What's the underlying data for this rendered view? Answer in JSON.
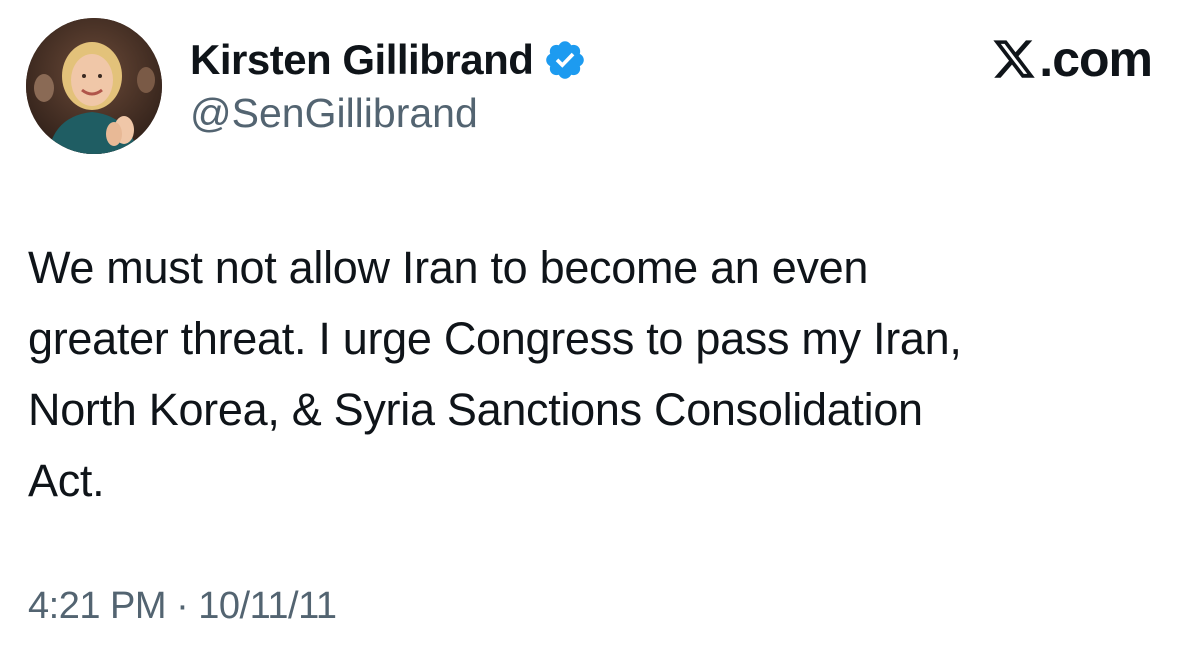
{
  "tweet": {
    "author": {
      "display_name": "Kirsten Gillibrand",
      "handle": "@SenGillibrand",
      "verified": true,
      "verified_icon": "verified-badge-icon",
      "avatar": "profile-photo"
    },
    "brand": {
      "logo_icon": "x-logo-icon",
      "text": ".com"
    },
    "text_lines": [
      "We must not allow Iran to become an even",
      "greater threat. I urge Congress to pass my Iran,",
      "North Korea, & Syria Sanctions Consolidation",
      "Act."
    ],
    "timestamp": "4:21 PM · 10/11/11"
  },
  "colors": {
    "primary_text": "#0f1419",
    "secondary_text": "#536471",
    "verified_blue": "#1d9bf0",
    "background": "#ffffff"
  }
}
